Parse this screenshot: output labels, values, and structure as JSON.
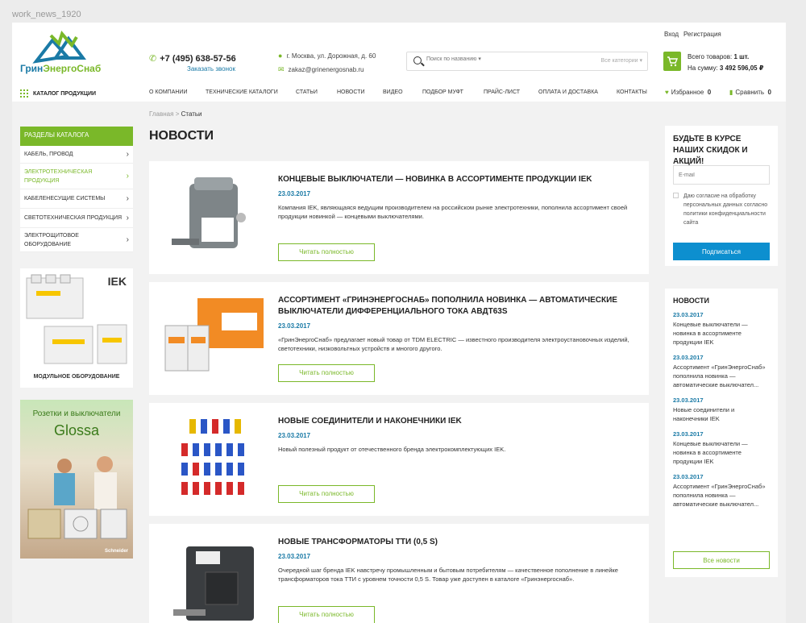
{
  "frame_label": "work_news_1920",
  "header": {
    "logo_text_1": "Грин",
    "logo_text_2": "ЭнергоСнаб",
    "phone": "+7 (495) 638-57-56",
    "callback": "Заказать звонок",
    "address": "г. Москва, ул. Дорожная, д. 60",
    "email": "zakaz@grinenergosnab.ru",
    "search_placeholder": "Поиск по названию ▾",
    "search_category": "Все категории ▾",
    "login": "Вход",
    "register": "Регистрация",
    "cart_count_label": "Всего товаров:",
    "cart_count_value": "1 шт.",
    "cart_sum_label": "На сумму:",
    "cart_sum_value": "3 492 596,05 ₽"
  },
  "nav": {
    "catalog": "КАТАЛОГ ПРОДУКЦИИ",
    "items": [
      "О КОМПАНИИ",
      "ТЕХНИЧЕСКИЕ КАТАЛОГИ",
      "СТАТЬИ",
      "НОВОСТИ",
      "ВИДЕО",
      "ПОДБОР МУФТ",
      "ПРАЙС-ЛИСТ",
      "ОПЛАТА И ДОСТАВКА",
      "КОНТАКТЫ"
    ],
    "favorites": "Избранное",
    "favorites_count": "0",
    "compare": "Сравнить",
    "compare_count": "0"
  },
  "breadcrumb": {
    "home": "Главная",
    "sep": ">",
    "current": "Статьи"
  },
  "page_title": "НОВОСТИ",
  "catalog_menu": {
    "title": "РАЗДЕЛЫ КАТАЛОГА",
    "items": [
      "КАБЕЛЬ, ПРОВОД",
      "ЭЛЕКТРОТЕХНИЧЕСКАЯ ПРОДУКЦИЯ",
      "КАБЕЛЕНЕСУЩИЕ СИСТЕМЫ",
      "СВЕТОТЕХНИЧЕСКАЯ ПРОДУКЦИЯ",
      "ЭЛЕКТРОЩИТОВОЕ ОБОРУДОВАНИЕ"
    ]
  },
  "banners": {
    "b1_brand": "IEK",
    "b1_caption": "МОДУЛЬНОЕ ОБОРУДОВАНИЕ",
    "b2_line1": "Розетки и выключатели",
    "b2_line2": "Glossa",
    "b2_brand": "Schneider"
  },
  "news": [
    {
      "title": "КОНЦЕВЫЕ ВЫКЛЮЧАТЕЛИ — НОВИНКА В АССОРТИМЕНТЕ ПРОДУКЦИИ IEK",
      "date": "23.03.2017",
      "text": "Компания IEK, являющаяся ведущим производителем на российском рынке электротехники, пополнила ассортимент своей продукции новинкой — концевыми выключателями.",
      "button": "Читать полностью"
    },
    {
      "title": "АССОРТИМЕНТ «ГРИНЭНЕРГОСНАБ» ПОПОЛНИЛА НОВИНКА — АВТОМАТИЧЕСКИЕ ВЫКЛЮЧАТЕЛИ ДИФФЕРЕНЦИАЛЬНОГО ТОКА АВДТ63S",
      "date": "23.03.2017",
      "text": "«ГринЭнергоСнаб» предлагает новый товар от TDM ELECTRIC — известного производителя электроустановочных изделий, светотехники, низковольтных устройств и многого другого.",
      "button": "Читать полностью"
    },
    {
      "title": "НОВЫЕ СОЕДИНИТЕЛИ И НАКОНЕЧНИКИ IEK",
      "date": "23.03.2017",
      "text": "Новый полезный продукт от отечественного бренда электрокомплектующих IEK.",
      "button": "Читать полностью"
    },
    {
      "title": " НОВЫЕ ТРАНСФОРМАТОРЫ ТТИ (0,5 S)",
      "date": "23.03.2017",
      "text": "Очередной шаг бренда IEK навстречу промышленным и бытовым потребителям — качественное пополнение в линейке трансформаторов тока ТТИ с уровнем точности 0,5 S. Товар уже доступен в каталоге «Гринэнергоснаб».",
      "button": "Читать полностью"
    }
  ],
  "subscribe": {
    "title": "БУДЬТЕ В КУРСЕ НАШИХ СКИДОК И АКЦИЙ!",
    "email_placeholder": "E-mail",
    "consent": "Даю согласие на обработку персональных данных согласно политики конфиденциальности сайта",
    "button": "Подписаться"
  },
  "side_news": {
    "title": "НОВОСТИ",
    "items": [
      {
        "date": "23.03.2017",
        "text": "Концевые выключатели — новинка в ассортименте продукции IEK"
      },
      {
        "date": "23.03.2017",
        "text": "Ассортимент «ГринЭнергоСнаб» пополнила новинка — автоматические выключател..."
      },
      {
        "date": "23.03.2017",
        "text": "Новые соединители и наконечники IEK"
      },
      {
        "date": "23.03.2017",
        "text": "Концевые выключатели — новинка в ассортименте продукции IEK"
      },
      {
        "date": "23.03.2017",
        "text": "Ассортимент «ГринЭнергоСнаб» пополнила новинка — автоматические выключател..."
      }
    ],
    "all_button": "Все новости"
  },
  "colors": {
    "green": "#7ab829",
    "blue": "#1a7aa6",
    "button_blue": "#0d8fcf"
  }
}
